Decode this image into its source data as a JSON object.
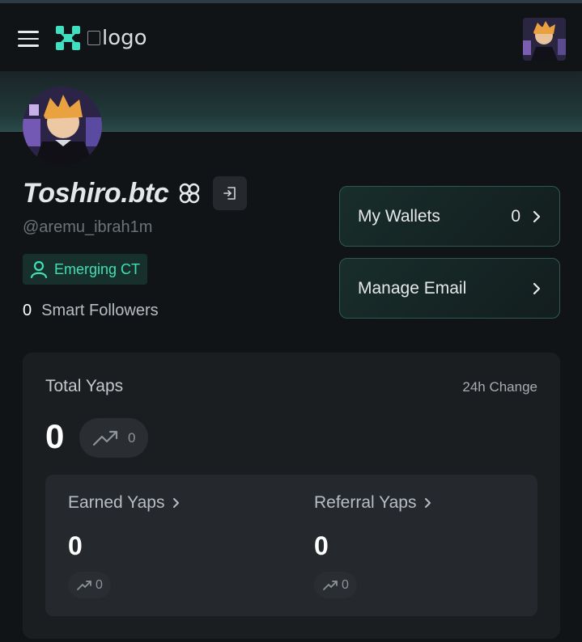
{
  "header": {
    "menu_icon": "hamburger-icon",
    "brand_icon": "x-brand-icon",
    "logo_alt": "logo",
    "accent": "#3ee0c0"
  },
  "profile": {
    "display_name": "Toshiro.btc",
    "handle": "@aremu_ibrah1m",
    "tier": "Emerging CT",
    "smart_followers_count": "0",
    "smart_followers_label": "Smart Followers"
  },
  "actions": {
    "wallets_label": "My Wallets",
    "wallets_count": "0",
    "email_label": "Manage Email"
  },
  "yaps": {
    "title": "Total Yaps",
    "change_label": "24h Change",
    "total": "0",
    "total_change": "0",
    "earned": {
      "label": "Earned Yaps",
      "value": "0",
      "change": "0"
    },
    "referral": {
      "label": "Referral Yaps",
      "value": "0",
      "change": "0"
    }
  }
}
